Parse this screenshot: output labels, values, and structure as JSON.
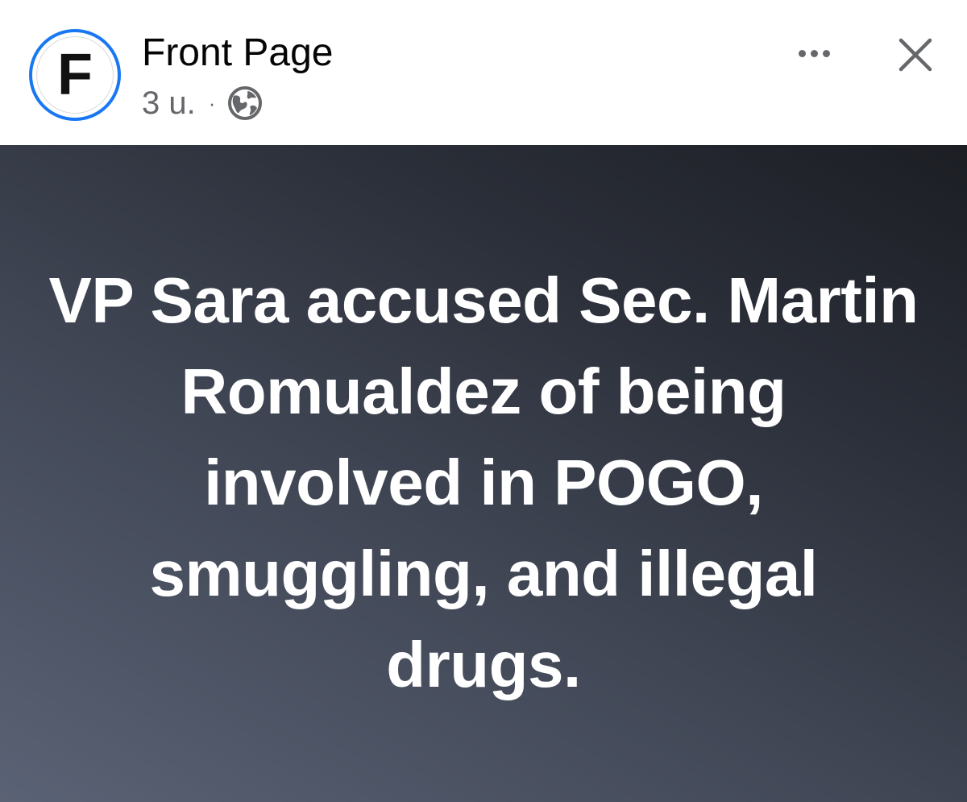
{
  "post": {
    "page_name": "Front Page",
    "avatar_letter": "F",
    "timestamp": "3 u.",
    "separator": "·",
    "audience_icon": "globe-icon",
    "more_icon": "more-horizontal-icon",
    "close_icon": "close-icon",
    "text": "VP Sara accused Sec. Martin Romualdez of being involved in POGO, smuggling, and illegal drugs."
  },
  "colors": {
    "avatar_ring": "#1877f2",
    "name_text": "#050505",
    "meta_text": "#65676b",
    "body_gradient": [
      "#5a6275",
      "#404654",
      "#2b2f39",
      "#1c1e24"
    ],
    "post_text": "#ffffff"
  }
}
